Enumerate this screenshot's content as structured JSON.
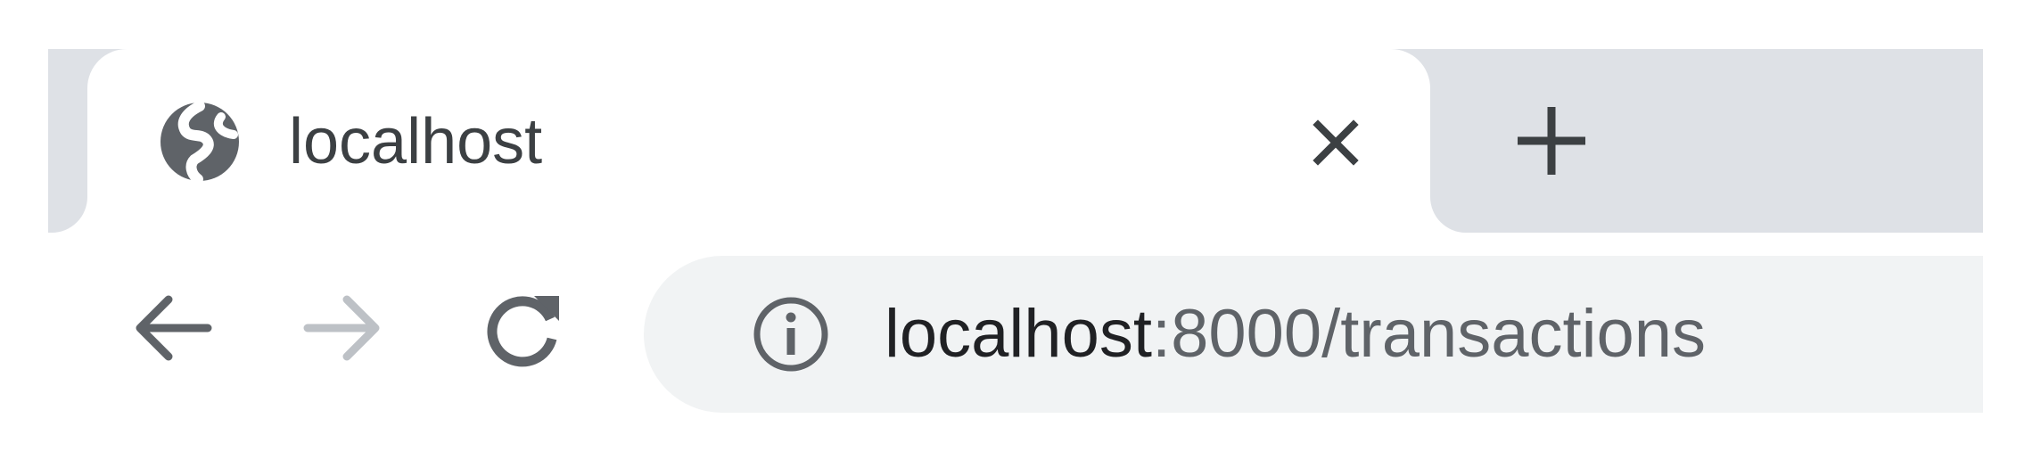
{
  "tabs": [
    {
      "title": "localhost",
      "favicon": "globe-icon",
      "active": true
    }
  ],
  "tab_strip": {
    "close_icon": "close-icon",
    "new_tab_icon": "plus-icon"
  },
  "toolbar": {
    "back_icon": "arrow-left-icon",
    "forward_icon": "arrow-right-icon",
    "reload_icon": "reload-icon",
    "forward_enabled": false
  },
  "omnibox": {
    "site_info_icon": "info-icon",
    "url_host": "localhost",
    "url_rest": ":8000/transactions"
  },
  "colors": {
    "tab_strip_bg": "#dee1e6",
    "active_tab_bg": "#ffffff",
    "omnibox_bg": "#f1f3f4",
    "icon_dark": "#5f6368",
    "icon_disabled": "#bdc1c6",
    "text_primary": "#202124"
  }
}
